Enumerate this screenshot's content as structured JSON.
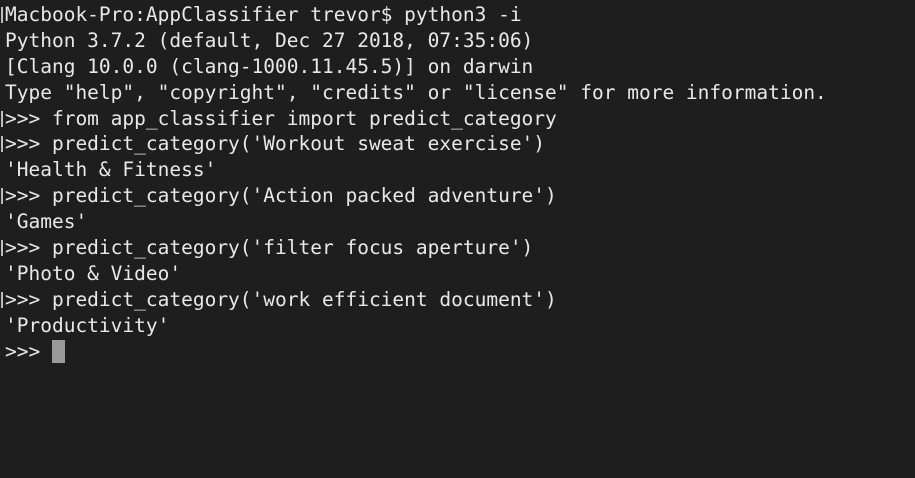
{
  "terminal": {
    "lines": [
      {
        "text": "Macbook-Pro:AppClassifier trevor$ python3 -i",
        "mark": true
      },
      {
        "text": "Python 3.7.2 (default, Dec 27 2018, 07:35:06)",
        "mark": false
      },
      {
        "text": "[Clang 10.0.0 (clang-1000.11.45.5)] on darwin",
        "mark": false
      },
      {
        "text": "Type \"help\", \"copyright\", \"credits\" or \"license\" for more information.",
        "mark": false
      },
      {
        "text": ">>> from app_classifier import predict_category",
        "mark": true
      },
      {
        "text": ">>> predict_category('Workout sweat exercise')",
        "mark": true
      },
      {
        "text": "'Health & Fitness'",
        "mark": false
      },
      {
        "text": ">>> predict_category('Action packed adventure')",
        "mark": true
      },
      {
        "text": "'Games'",
        "mark": false
      },
      {
        "text": ">>> predict_category('filter focus aperture')",
        "mark": true
      },
      {
        "text": "'Photo & Video'",
        "mark": false
      },
      {
        "text": ">>> predict_category('work efficient document')",
        "mark": true
      },
      {
        "text": "'Productivity'",
        "mark": false
      }
    ],
    "prompt": ">>>"
  },
  "colors": {
    "background": "#1e1e1e",
    "text": "#e8e8e8",
    "cursor": "#9a9a9a"
  }
}
